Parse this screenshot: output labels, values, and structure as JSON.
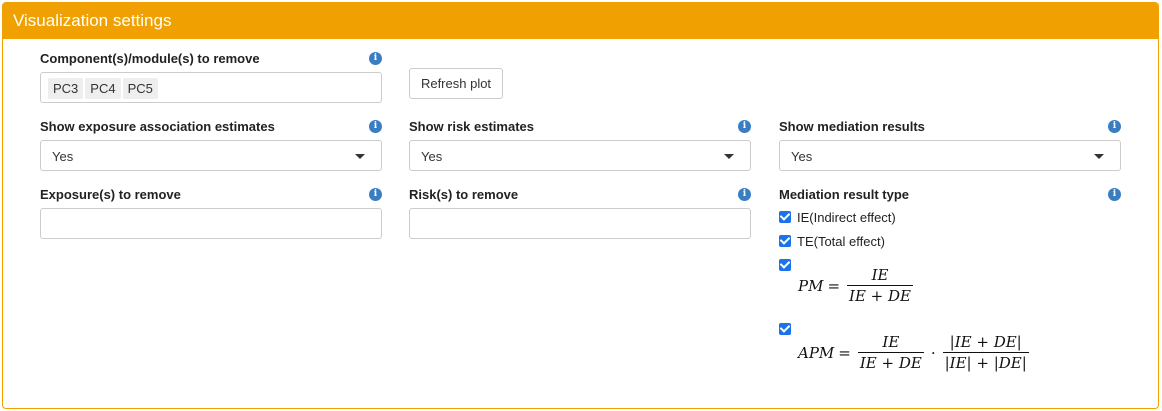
{
  "panel": {
    "title": "Visualization settings"
  },
  "components": {
    "label": "Component(s)/module(s) to remove",
    "chips": [
      "PC3",
      "PC4",
      "PC5"
    ]
  },
  "refresh": {
    "label": "Refresh plot"
  },
  "exposure_assoc": {
    "label": "Show exposure association estimates",
    "value": "Yes"
  },
  "risk_est": {
    "label": "Show risk estimates",
    "value": "Yes"
  },
  "mediation": {
    "label": "Show mediation results",
    "value": "Yes"
  },
  "exposure_remove": {
    "label": "Exposure(s) to remove",
    "value": ""
  },
  "risk_remove": {
    "label": "Risk(s) to remove",
    "value": ""
  },
  "med_type": {
    "label": "Mediation result type",
    "options": [
      {
        "label": "IE(Indirect effect)",
        "checked": true
      },
      {
        "label": "TE(Total effect)",
        "checked": true
      },
      {
        "label": "PM",
        "checked": true
      },
      {
        "label": "APM",
        "checked": true
      }
    ],
    "pm": {
      "lhs": "PM",
      "num": "IE",
      "den": "IE + DE"
    },
    "apm": {
      "lhs": "APM",
      "num1": "IE",
      "den1": "IE + DE",
      "num2": "|IE + DE|",
      "den2": "|IE| + |DE|"
    }
  },
  "icons": {
    "info": "info-icon",
    "dropdown": "chevron-down-icon",
    "check": "checkbox-checked-icon"
  },
  "colors": {
    "header": "#f0a000",
    "info": "#3a7ec2",
    "checkbox": "#1a73e8"
  }
}
